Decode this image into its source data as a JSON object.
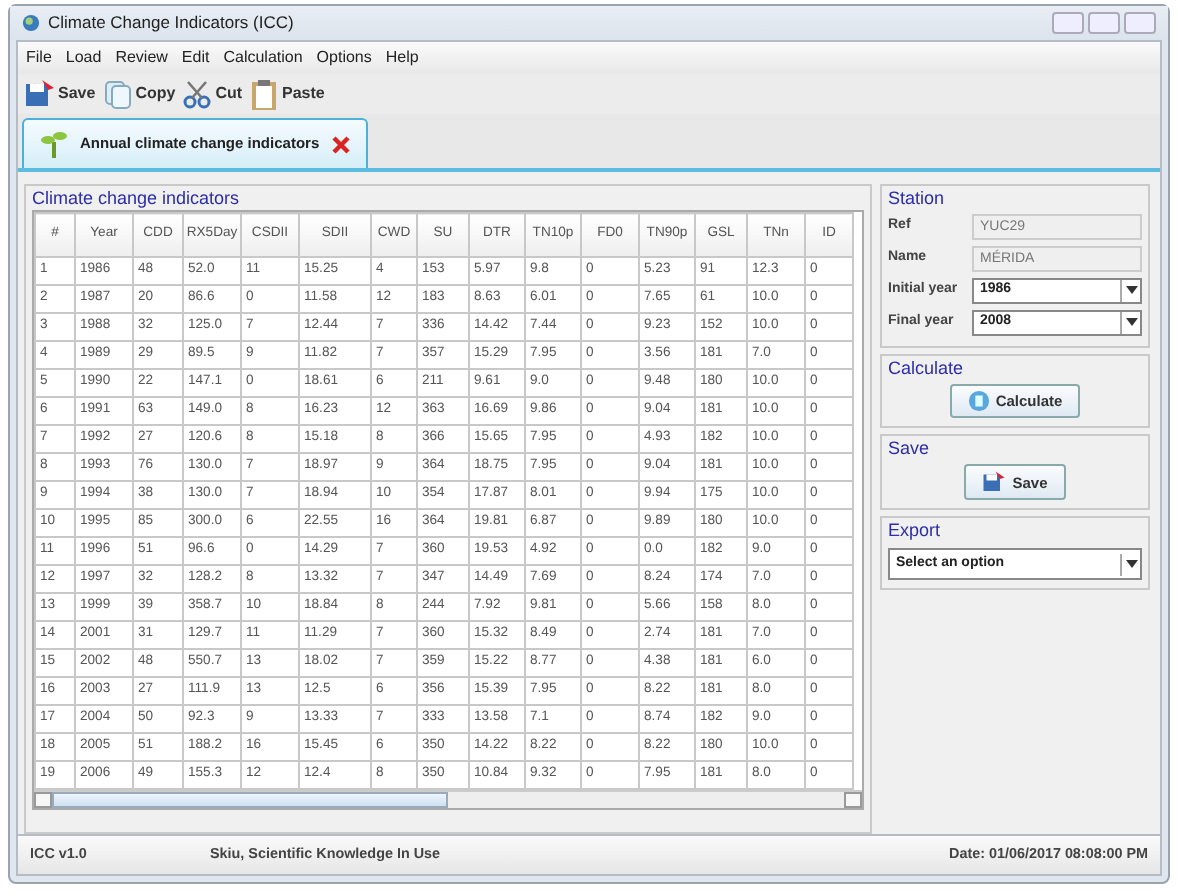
{
  "window": {
    "title": "Climate Change Indicators (ICC)"
  },
  "menu": [
    "File",
    "Load",
    "Review",
    "Edit",
    "Calculation",
    "Options",
    "Help"
  ],
  "toolbar": [
    {
      "kind": "save",
      "label": "Save"
    },
    {
      "kind": "copy",
      "label": "Copy"
    },
    {
      "kind": "cut",
      "label": "Cut"
    },
    {
      "kind": "paste",
      "label": "Paste"
    }
  ],
  "tabs": [
    {
      "label": "Annual climate change indicators",
      "selected": true
    }
  ],
  "table": {
    "title": "Climate change indicators",
    "columns": [
      "#",
      "Year",
      "CDD",
      "RX5Day",
      "CSDII",
      "SDII",
      "CWD",
      "SU",
      "DTR",
      "TN10p",
      "FD0",
      "TN90p",
      "GSL",
      "TNn",
      "ID"
    ],
    "rows": [
      [
        "1",
        "1986",
        "48",
        "52.0",
        "11",
        "15.25",
        "4",
        "153",
        "5.97",
        "9.8",
        "0",
        "5.23",
        "91",
        "12.3",
        "0"
      ],
      [
        "2",
        "1987",
        "20",
        "86.6",
        "0",
        "11.58",
        "12",
        "183",
        "8.63",
        "6.01",
        "0",
        "7.65",
        "61",
        "10.0",
        "0"
      ],
      [
        "3",
        "1988",
        "32",
        "125.0",
        "7",
        "12.44",
        "7",
        "336",
        "14.42",
        "7.44",
        "0",
        "9.23",
        "152",
        "10.0",
        "0"
      ],
      [
        "4",
        "1989",
        "29",
        "89.5",
        "9",
        "11.82",
        "7",
        "357",
        "15.29",
        "7.95",
        "0",
        "3.56",
        "181",
        "7.0",
        "0"
      ],
      [
        "5",
        "1990",
        "22",
        "147.1",
        "0",
        "18.61",
        "6",
        "211",
        "9.61",
        "9.0",
        "0",
        "9.48",
        "180",
        "10.0",
        "0"
      ],
      [
        "6",
        "1991",
        "63",
        "149.0",
        "8",
        "16.23",
        "12",
        "363",
        "16.69",
        "9.86",
        "0",
        "9.04",
        "181",
        "10.0",
        "0"
      ],
      [
        "7",
        "1992",
        "27",
        "120.6",
        "8",
        "15.18",
        "8",
        "366",
        "15.65",
        "7.95",
        "0",
        "4.93",
        "182",
        "10.0",
        "0"
      ],
      [
        "8",
        "1993",
        "76",
        "130.0",
        "7",
        "18.97",
        "9",
        "364",
        "18.75",
        "7.95",
        "0",
        "9.04",
        "181",
        "10.0",
        "0"
      ],
      [
        "9",
        "1994",
        "38",
        "130.0",
        "7",
        "18.94",
        "10",
        "354",
        "17.87",
        "8.01",
        "0",
        "9.94",
        "175",
        "10.0",
        "0"
      ],
      [
        "10",
        "1995",
        "85",
        "300.0",
        "6",
        "22.55",
        "16",
        "364",
        "19.81",
        "6.87",
        "0",
        "9.89",
        "180",
        "10.0",
        "0"
      ],
      [
        "11",
        "1996",
        "51",
        "96.6",
        "0",
        "14.29",
        "7",
        "360",
        "19.53",
        "4.92",
        "0",
        "0.0",
        "182",
        "9.0",
        "0"
      ],
      [
        "12",
        "1997",
        "32",
        "128.2",
        "8",
        "13.32",
        "7",
        "347",
        "14.49",
        "7.69",
        "0",
        "8.24",
        "174",
        "7.0",
        "0"
      ],
      [
        "13",
        "1999",
        "39",
        "358.7",
        "10",
        "18.84",
        "8",
        "244",
        "7.92",
        "9.81",
        "0",
        "5.66",
        "158",
        "8.0",
        "0"
      ],
      [
        "14",
        "2001",
        "31",
        "129.7",
        "11",
        "11.29",
        "7",
        "360",
        "15.32",
        "8.49",
        "0",
        "2.74",
        "181",
        "7.0",
        "0"
      ],
      [
        "15",
        "2002",
        "48",
        "550.7",
        "13",
        "18.02",
        "7",
        "359",
        "15.22",
        "8.77",
        "0",
        "4.38",
        "181",
        "6.0",
        "0"
      ],
      [
        "16",
        "2003",
        "27",
        "111.9",
        "13",
        "12.5",
        "6",
        "356",
        "15.39",
        "7.95",
        "0",
        "8.22",
        "181",
        "8.0",
        "0"
      ],
      [
        "17",
        "2004",
        "50",
        "92.3",
        "9",
        "13.33",
        "7",
        "333",
        "13.58",
        "7.1",
        "0",
        "8.74",
        "182",
        "9.0",
        "0"
      ],
      [
        "18",
        "2005",
        "51",
        "188.2",
        "16",
        "15.45",
        "6",
        "350",
        "14.22",
        "8.22",
        "0",
        "8.22",
        "180",
        "10.0",
        "0"
      ],
      [
        "19",
        "2006",
        "49",
        "155.3",
        "12",
        "12.4",
        "8",
        "350",
        "10.84",
        "9.32",
        "0",
        "7.95",
        "181",
        "8.0",
        "0"
      ]
    ]
  },
  "station": {
    "title": "Station",
    "fields": [
      {
        "kind": "text",
        "label": "Ref",
        "value": "YUC29"
      },
      {
        "kind": "text",
        "label": "Name",
        "value": "MÉRIDA"
      },
      {
        "kind": "select",
        "label": "Initial year",
        "value": "1986"
      },
      {
        "kind": "select",
        "label": "Final year",
        "value": "2008"
      }
    ]
  },
  "calculate": {
    "title": "Calculate",
    "button": "Calculate"
  },
  "save": {
    "title": "Save",
    "button": "Save"
  },
  "export": {
    "title": "Export",
    "value": "Select an option"
  },
  "status_bar": {
    "version": "ICC v1.0",
    "company": "Skiu, Scientific Knowledge In Use",
    "date": "Date: 01/06/2017  08:08:00 PM"
  }
}
